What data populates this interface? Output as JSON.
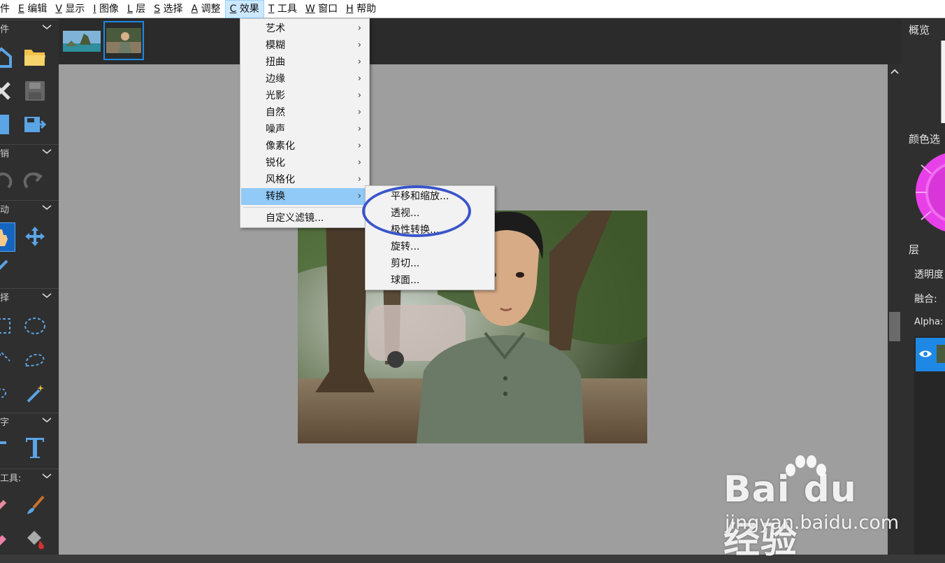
{
  "menubar": {
    "items": [
      {
        "key": "",
        "label": "件"
      },
      {
        "key": "E",
        "label": "编辑"
      },
      {
        "key": "V",
        "label": "显示"
      },
      {
        "key": "I",
        "label": "图像"
      },
      {
        "key": "L",
        "label": "层"
      },
      {
        "key": "S",
        "label": "选择"
      },
      {
        "key": "A",
        "label": "调整"
      },
      {
        "key": "C",
        "label": "效果"
      },
      {
        "key": "T",
        "label": "工具"
      },
      {
        "key": "W",
        "label": "窗口"
      },
      {
        "key": "H",
        "label": "帮助"
      }
    ]
  },
  "left_toolbar": {
    "sections": [
      "件",
      "销",
      "动",
      "择",
      "字",
      "工具:"
    ]
  },
  "effects_menu": {
    "items": [
      "艺术",
      "模糊",
      "扭曲",
      "边缘",
      "光影",
      "自然",
      "噪声",
      "像素化",
      "锐化",
      "风格化",
      "转换"
    ],
    "custom": "自定义滤镜...",
    "highlighted": "转换"
  },
  "transform_submenu": {
    "items": [
      "平移和缩放...",
      "透视...",
      "极性转换...",
      "旋转...",
      "剪切...",
      "球面..."
    ]
  },
  "right_panel": {
    "overview_title": "概览",
    "color_title": "颜色选",
    "layers_title": "层",
    "opacity_label": "透明度",
    "blend_label": "融合:",
    "alpha_label": "Alpha:"
  },
  "watermark": {
    "logo": "Bai du 经验",
    "url": "jingyan.baidu.com"
  },
  "colors": {
    "accent": "#1e88e5",
    "menu_highlight": "#91c9f7",
    "annotation": "#3a55c9"
  }
}
